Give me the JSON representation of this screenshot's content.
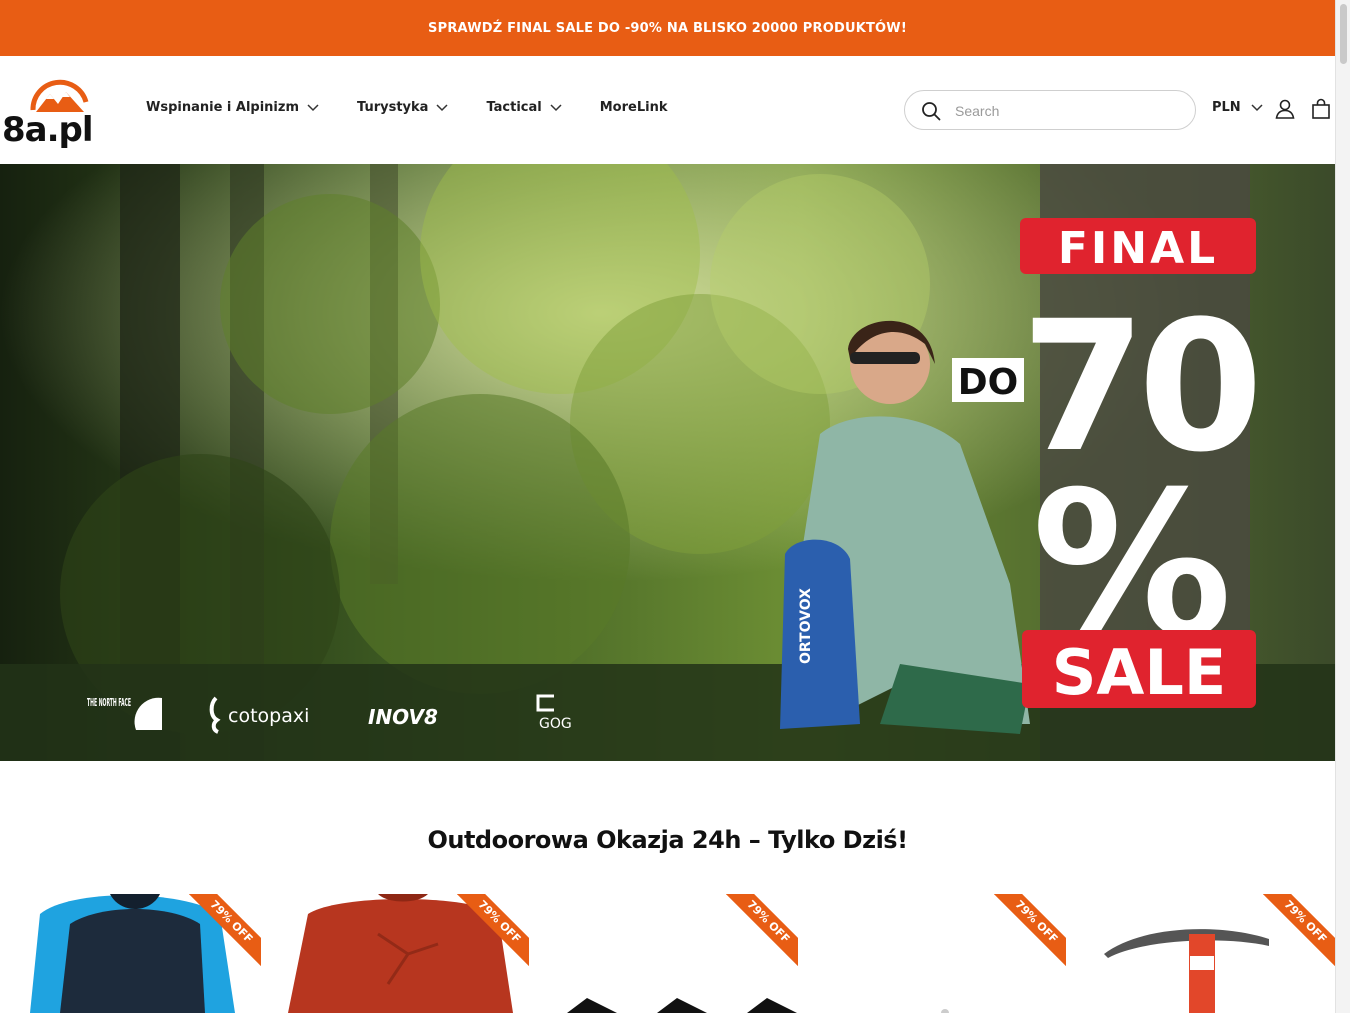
{
  "announcement": {
    "text": "SPRAWDŹ FINAL SALE DO -90% NA BLISKO 20000 PRODUKTÓW!"
  },
  "header": {
    "logo_text": "8a.pl",
    "nav": [
      {
        "label": "Wspinanie i Alpinizm",
        "has_dropdown": true
      },
      {
        "label": "Turystyka",
        "has_dropdown": true
      },
      {
        "label": "Tactical",
        "has_dropdown": true
      },
      {
        "label": "MoreLink",
        "has_dropdown": false
      }
    ],
    "search": {
      "placeholder": "Search",
      "value": ""
    },
    "currency": "PLN"
  },
  "hero": {
    "badge_top": "FINAL",
    "badge_do": "DO",
    "badge_number": "70",
    "badge_percent": "%",
    "badge_bottom": "SALE",
    "backpack_brand": "ORTOVOX",
    "brands": [
      "THE NORTH FACE",
      "cotopaxi",
      "INOV8",
      "GOG"
    ]
  },
  "section": {
    "title": "Outdoorowa Okazja 24h – Tylko Dziś!"
  },
  "products": [
    {
      "badge": "79% OFF"
    },
    {
      "badge": "79% OFF"
    },
    {
      "badge": "79% OFF"
    },
    {
      "badge": "79% OFF"
    },
    {
      "badge": "79% OFF"
    }
  ],
  "colors": {
    "accent": "#e85d14",
    "sale_red": "#e0232e",
    "text": "#111111"
  }
}
